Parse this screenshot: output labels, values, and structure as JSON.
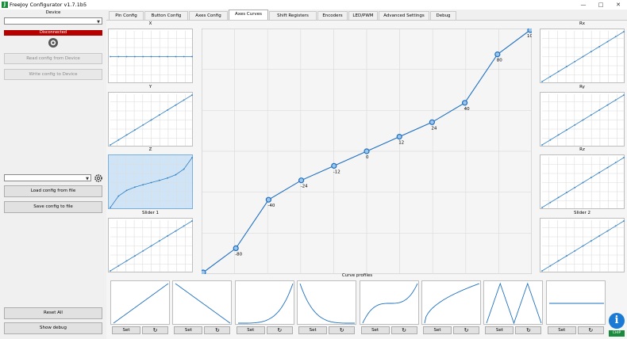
{
  "window": {
    "title": "FreeJoy Configurator v1.7.1b5",
    "icon_letter": "J"
  },
  "left_panel": {
    "device_label": "Device",
    "device_select_value": "",
    "status": "Disconnected",
    "status_color": "#b50000",
    "read_button": "Read config from Device",
    "write_button": "Write config to Device",
    "config_select_value": "",
    "load_file_button": "Load config from file",
    "save_file_button": "Save config to file",
    "reset_all_button": "Reset All",
    "show_debug_button": "Show debug"
  },
  "tabs": [
    {
      "label": "Pin Config"
    },
    {
      "label": "Button Config"
    },
    {
      "label": "Axes Config"
    },
    {
      "label": "Axes Curves",
      "active": true
    },
    {
      "label": "Shift Registers"
    },
    {
      "label": "Encoders"
    },
    {
      "label": "LED/PWM"
    },
    {
      "label": "Advanced Settings"
    },
    {
      "label": "Debug"
    }
  ],
  "left_axes": [
    {
      "label": "X",
      "curve": "flat"
    },
    {
      "label": "Y",
      "curve": "linear"
    },
    {
      "label": "Z",
      "curve": "scurve",
      "selected": true
    },
    {
      "label": "Slider 1",
      "curve": "linear"
    }
  ],
  "right_axes": [
    {
      "label": "Rx",
      "curve": "linear"
    },
    {
      "label": "Ry",
      "curve": "linear"
    },
    {
      "label": "Rz",
      "curve": "linear"
    },
    {
      "label": "Slider 2",
      "curve": "linear"
    }
  ],
  "main_curve": {
    "point_labels": [
      "-100",
      "-80",
      "-40",
      "-24",
      "-12",
      "0",
      "12",
      "24",
      "40",
      "80",
      "100"
    ],
    "line_color": "#1e6fc0"
  },
  "curve_profiles": {
    "title": "Curve profiles",
    "items": [
      {
        "shape": "linear",
        "set_label": "Set"
      },
      {
        "shape": "inverse",
        "set_label": "Set"
      },
      {
        "shape": "exponential",
        "set_label": "Set"
      },
      {
        "shape": "decay",
        "set_label": "Set"
      },
      {
        "shape": "scurve",
        "set_label": "Set"
      },
      {
        "shape": "log",
        "set_label": "Set"
      },
      {
        "shape": "zigzag",
        "set_label": "Set"
      },
      {
        "shape": "flat",
        "set_label": "Set"
      }
    ]
  },
  "info_icon": "i",
  "status_badge": "CHIP"
}
